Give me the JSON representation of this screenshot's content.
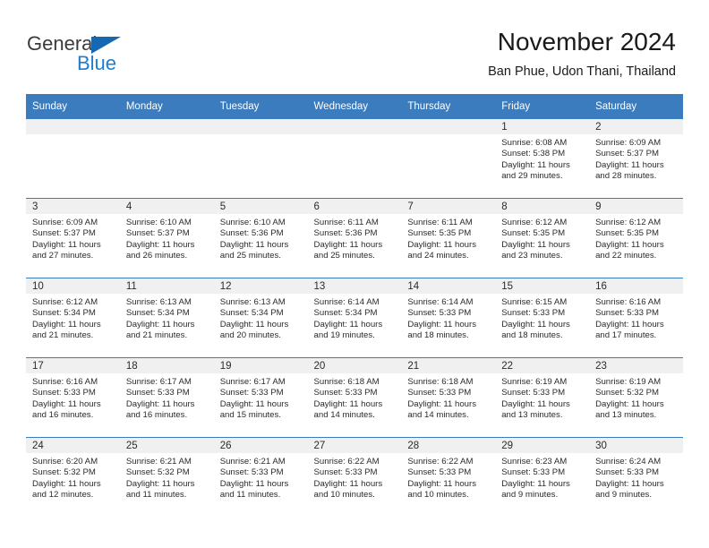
{
  "brand": {
    "name_part1": "General",
    "name_part2": "Blue",
    "accent_color": "#1668b3",
    "blue_text_color": "#1a7fd4"
  },
  "header": {
    "title": "November 2024",
    "subtitle": "Ban Phue, Udon Thani, Thailand"
  },
  "theme": {
    "header_row_bg": "#3a7cbe",
    "day_strip_bg": "#f0f0f0",
    "cell_bg": "#ffffff",
    "text_color": "#2b2b2b"
  },
  "weekdays": [
    "Sunday",
    "Monday",
    "Tuesday",
    "Wednesday",
    "Thursday",
    "Friday",
    "Saturday"
  ],
  "labels": {
    "sunrise_prefix": "Sunrise:",
    "sunset_prefix": "Sunset:",
    "daylight_prefix": "Daylight:"
  },
  "weeks": [
    [
      {
        "day": "",
        "sunrise": "",
        "sunset": "",
        "daylight_line1": "",
        "daylight_line2": ""
      },
      {
        "day": "",
        "sunrise": "",
        "sunset": "",
        "daylight_line1": "",
        "daylight_line2": ""
      },
      {
        "day": "",
        "sunrise": "",
        "sunset": "",
        "daylight_line1": "",
        "daylight_line2": ""
      },
      {
        "day": "",
        "sunrise": "",
        "sunset": "",
        "daylight_line1": "",
        "daylight_line2": ""
      },
      {
        "day": "",
        "sunrise": "",
        "sunset": "",
        "daylight_line1": "",
        "daylight_line2": ""
      },
      {
        "day": "1",
        "sunrise": "Sunrise: 6:08 AM",
        "sunset": "Sunset: 5:38 PM",
        "daylight_line1": "Daylight: 11 hours",
        "daylight_line2": "and 29 minutes."
      },
      {
        "day": "2",
        "sunrise": "Sunrise: 6:09 AM",
        "sunset": "Sunset: 5:37 PM",
        "daylight_line1": "Daylight: 11 hours",
        "daylight_line2": "and 28 minutes."
      }
    ],
    [
      {
        "day": "3",
        "sunrise": "Sunrise: 6:09 AM",
        "sunset": "Sunset: 5:37 PM",
        "daylight_line1": "Daylight: 11 hours",
        "daylight_line2": "and 27 minutes."
      },
      {
        "day": "4",
        "sunrise": "Sunrise: 6:10 AM",
        "sunset": "Sunset: 5:37 PM",
        "daylight_line1": "Daylight: 11 hours",
        "daylight_line2": "and 26 minutes."
      },
      {
        "day": "5",
        "sunrise": "Sunrise: 6:10 AM",
        "sunset": "Sunset: 5:36 PM",
        "daylight_line1": "Daylight: 11 hours",
        "daylight_line2": "and 25 minutes."
      },
      {
        "day": "6",
        "sunrise": "Sunrise: 6:11 AM",
        "sunset": "Sunset: 5:36 PM",
        "daylight_line1": "Daylight: 11 hours",
        "daylight_line2": "and 25 minutes."
      },
      {
        "day": "7",
        "sunrise": "Sunrise: 6:11 AM",
        "sunset": "Sunset: 5:35 PM",
        "daylight_line1": "Daylight: 11 hours",
        "daylight_line2": "and 24 minutes."
      },
      {
        "day": "8",
        "sunrise": "Sunrise: 6:12 AM",
        "sunset": "Sunset: 5:35 PM",
        "daylight_line1": "Daylight: 11 hours",
        "daylight_line2": "and 23 minutes."
      },
      {
        "day": "9",
        "sunrise": "Sunrise: 6:12 AM",
        "sunset": "Sunset: 5:35 PM",
        "daylight_line1": "Daylight: 11 hours",
        "daylight_line2": "and 22 minutes."
      }
    ],
    [
      {
        "day": "10",
        "sunrise": "Sunrise: 6:12 AM",
        "sunset": "Sunset: 5:34 PM",
        "daylight_line1": "Daylight: 11 hours",
        "daylight_line2": "and 21 minutes."
      },
      {
        "day": "11",
        "sunrise": "Sunrise: 6:13 AM",
        "sunset": "Sunset: 5:34 PM",
        "daylight_line1": "Daylight: 11 hours",
        "daylight_line2": "and 21 minutes."
      },
      {
        "day": "12",
        "sunrise": "Sunrise: 6:13 AM",
        "sunset": "Sunset: 5:34 PM",
        "daylight_line1": "Daylight: 11 hours",
        "daylight_line2": "and 20 minutes."
      },
      {
        "day": "13",
        "sunrise": "Sunrise: 6:14 AM",
        "sunset": "Sunset: 5:34 PM",
        "daylight_line1": "Daylight: 11 hours",
        "daylight_line2": "and 19 minutes."
      },
      {
        "day": "14",
        "sunrise": "Sunrise: 6:14 AM",
        "sunset": "Sunset: 5:33 PM",
        "daylight_line1": "Daylight: 11 hours",
        "daylight_line2": "and 18 minutes."
      },
      {
        "day": "15",
        "sunrise": "Sunrise: 6:15 AM",
        "sunset": "Sunset: 5:33 PM",
        "daylight_line1": "Daylight: 11 hours",
        "daylight_line2": "and 18 minutes."
      },
      {
        "day": "16",
        "sunrise": "Sunrise: 6:16 AM",
        "sunset": "Sunset: 5:33 PM",
        "daylight_line1": "Daylight: 11 hours",
        "daylight_line2": "and 17 minutes."
      }
    ],
    [
      {
        "day": "17",
        "sunrise": "Sunrise: 6:16 AM",
        "sunset": "Sunset: 5:33 PM",
        "daylight_line1": "Daylight: 11 hours",
        "daylight_line2": "and 16 minutes."
      },
      {
        "day": "18",
        "sunrise": "Sunrise: 6:17 AM",
        "sunset": "Sunset: 5:33 PM",
        "daylight_line1": "Daylight: 11 hours",
        "daylight_line2": "and 16 minutes."
      },
      {
        "day": "19",
        "sunrise": "Sunrise: 6:17 AM",
        "sunset": "Sunset: 5:33 PM",
        "daylight_line1": "Daylight: 11 hours",
        "daylight_line2": "and 15 minutes."
      },
      {
        "day": "20",
        "sunrise": "Sunrise: 6:18 AM",
        "sunset": "Sunset: 5:33 PM",
        "daylight_line1": "Daylight: 11 hours",
        "daylight_line2": "and 14 minutes."
      },
      {
        "day": "21",
        "sunrise": "Sunrise: 6:18 AM",
        "sunset": "Sunset: 5:33 PM",
        "daylight_line1": "Daylight: 11 hours",
        "daylight_line2": "and 14 minutes."
      },
      {
        "day": "22",
        "sunrise": "Sunrise: 6:19 AM",
        "sunset": "Sunset: 5:33 PM",
        "daylight_line1": "Daylight: 11 hours",
        "daylight_line2": "and 13 minutes."
      },
      {
        "day": "23",
        "sunrise": "Sunrise: 6:19 AM",
        "sunset": "Sunset: 5:32 PM",
        "daylight_line1": "Daylight: 11 hours",
        "daylight_line2": "and 13 minutes."
      }
    ],
    [
      {
        "day": "24",
        "sunrise": "Sunrise: 6:20 AM",
        "sunset": "Sunset: 5:32 PM",
        "daylight_line1": "Daylight: 11 hours",
        "daylight_line2": "and 12 minutes."
      },
      {
        "day": "25",
        "sunrise": "Sunrise: 6:21 AM",
        "sunset": "Sunset: 5:32 PM",
        "daylight_line1": "Daylight: 11 hours",
        "daylight_line2": "and 11 minutes."
      },
      {
        "day": "26",
        "sunrise": "Sunrise: 6:21 AM",
        "sunset": "Sunset: 5:33 PM",
        "daylight_line1": "Daylight: 11 hours",
        "daylight_line2": "and 11 minutes."
      },
      {
        "day": "27",
        "sunrise": "Sunrise: 6:22 AM",
        "sunset": "Sunset: 5:33 PM",
        "daylight_line1": "Daylight: 11 hours",
        "daylight_line2": "and 10 minutes."
      },
      {
        "day": "28",
        "sunrise": "Sunrise: 6:22 AM",
        "sunset": "Sunset: 5:33 PM",
        "daylight_line1": "Daylight: 11 hours",
        "daylight_line2": "and 10 minutes."
      },
      {
        "day": "29",
        "sunrise": "Sunrise: 6:23 AM",
        "sunset": "Sunset: 5:33 PM",
        "daylight_line1": "Daylight: 11 hours",
        "daylight_line2": "and 9 minutes."
      },
      {
        "day": "30",
        "sunrise": "Sunrise: 6:24 AM",
        "sunset": "Sunset: 5:33 PM",
        "daylight_line1": "Daylight: 11 hours",
        "daylight_line2": "and 9 minutes."
      }
    ]
  ]
}
